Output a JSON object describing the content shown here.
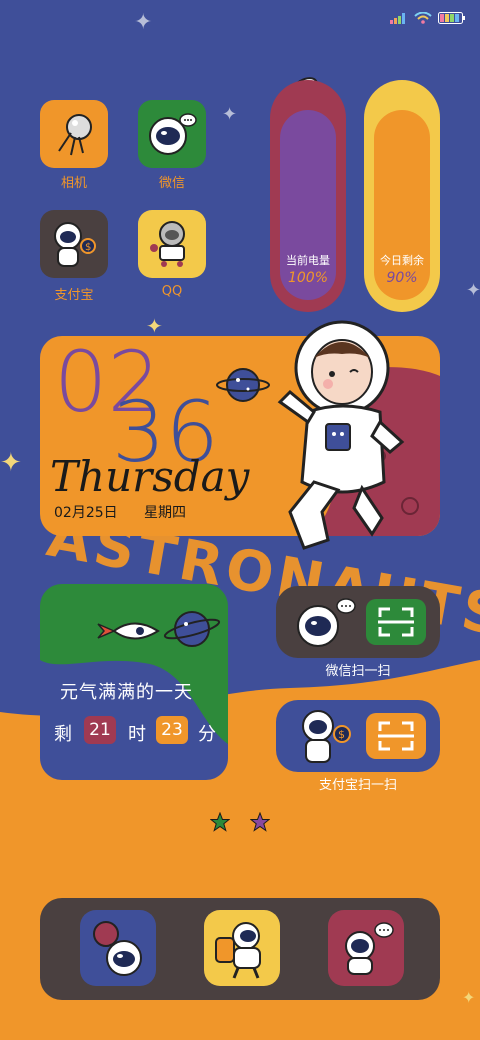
{
  "apps": {
    "camera": "相机",
    "wechat": "微信",
    "alipay": "支付宝",
    "qq": "QQ"
  },
  "battery_widget": {
    "title": "当前电量",
    "value": "100%"
  },
  "remain_widget": {
    "title": "今日剩余",
    "value": "90%"
  },
  "clock_widget": {
    "hour": "02",
    "minute": "36",
    "weekday_en": "Thursday",
    "date": "02月25日",
    "weekday_cn": "星期四"
  },
  "countdown_widget": {
    "slogan": "元气满满的一天",
    "prefix": "剩",
    "hours": "21",
    "hours_unit": "时",
    "minutes": "23",
    "minutes_unit": "分"
  },
  "shortcuts": {
    "wechat_scan": "微信扫一扫",
    "alipay_scan": "支付宝扫一扫"
  },
  "background_text": "ASTRONAUTS",
  "colors": {
    "background_blue": "#3f4f99",
    "accent_orange": "#f0962a",
    "purple": "#7a4a9e",
    "crimson": "#a03a52",
    "yellow": "#f3c94a",
    "green": "#2d8a3a",
    "dark": "#4a4040"
  }
}
